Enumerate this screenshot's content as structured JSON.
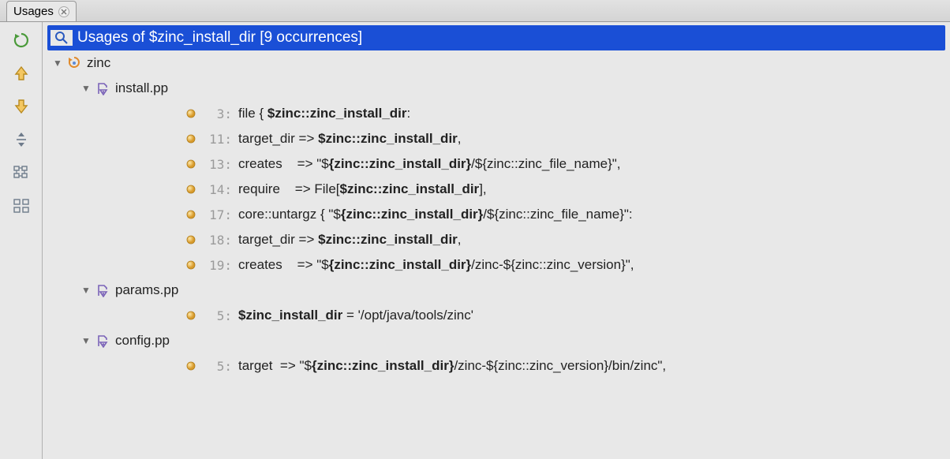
{
  "tab": {
    "label": "Usages"
  },
  "header": {
    "title": "Usages of $zinc_install_dir [9 occurrences]"
  },
  "module": {
    "name": "zinc"
  },
  "files": [
    {
      "name": "install.pp",
      "usages": [
        {
          "line": 3,
          "pre": "file { ",
          "bold": "$zinc::zinc_install_dir",
          "post": ":"
        },
        {
          "line": 11,
          "pre": "target_dir => ",
          "bold": "$zinc::zinc_install_dir",
          "post": ","
        },
        {
          "line": 13,
          "pre": "creates    => \"$",
          "bold": "{zinc::zinc_install_dir}",
          "post": "/${zinc::zinc_file_name}\","
        },
        {
          "line": 14,
          "pre": "require    => File[",
          "bold": "$zinc::zinc_install_dir",
          "post": "],"
        },
        {
          "line": 17,
          "pre": "core::untargz { \"$",
          "bold": "{zinc::zinc_install_dir}",
          "post": "/${zinc::zinc_file_name}\":"
        },
        {
          "line": 18,
          "pre": "target_dir => ",
          "bold": "$zinc::zinc_install_dir",
          "post": ","
        },
        {
          "line": 19,
          "pre": "creates    => \"$",
          "bold": "{zinc::zinc_install_dir}",
          "post": "/zinc-${zinc::zinc_version}\","
        }
      ]
    },
    {
      "name": "params.pp",
      "usages": [
        {
          "line": 5,
          "pre": "",
          "bold": "$zinc_install_dir",
          "post": " = '/opt/java/tools/zinc'"
        }
      ]
    },
    {
      "name": "config.pp",
      "usages": [
        {
          "line": 5,
          "pre": "target  => \"$",
          "bold": "{zinc::zinc_install_dir}",
          "post": "/zinc-${zinc::zinc_version}/bin/zinc\","
        }
      ]
    }
  ]
}
